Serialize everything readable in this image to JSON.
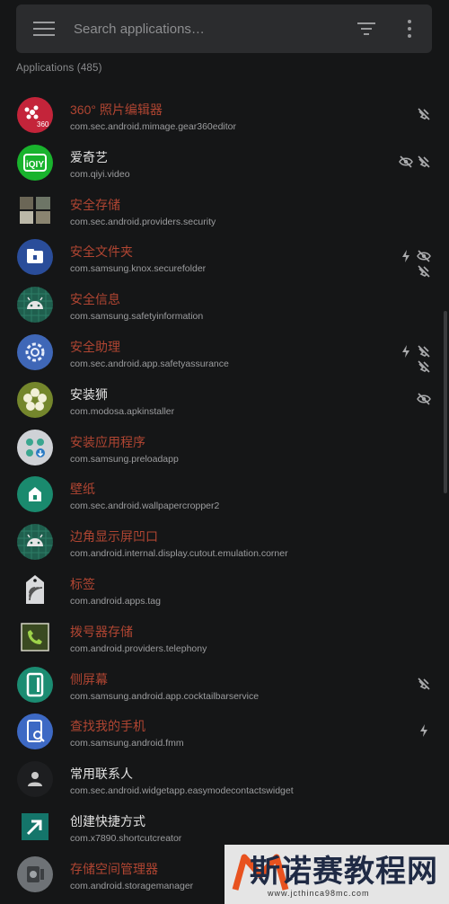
{
  "search": {
    "placeholder": "Search applications…"
  },
  "section_header": "Applications (485)",
  "colors": {
    "background": "#151617",
    "search_bar": "#2b2c2e",
    "disabled_text": "#b04532",
    "enabled_text": "#e2e2e2",
    "package_text": "#9c9d9f"
  },
  "apps": [
    {
      "name": "360° 照片编辑器",
      "package": "com.sec.android.mimage.gear360editor",
      "state": "disabled",
      "icon": "gear360-icon",
      "flags": [
        "ops-off-icon"
      ]
    },
    {
      "name": "爱奇艺",
      "package": "com.qiyi.video",
      "state": "enabled",
      "icon": "iqiyi-icon",
      "flags": [
        "hidden-icon",
        "ops-off-icon"
      ]
    },
    {
      "name": "安全存储",
      "package": "com.sec.android.providers.security",
      "state": "disabled",
      "icon": "storage-tiles-icon",
      "flags": []
    },
    {
      "name": "安全文件夹",
      "package": "com.samsung.knox.securefolder",
      "state": "disabled",
      "icon": "secure-folder-icon",
      "flags": [
        "trace-icon",
        "hidden-icon",
        "ops-off-icon"
      ]
    },
    {
      "name": "安全信息",
      "package": "com.samsung.safetyinformation",
      "state": "disabled",
      "icon": "android-icon",
      "flags": []
    },
    {
      "name": "安全助理",
      "package": "com.sec.android.app.safetyassurance",
      "state": "disabled",
      "icon": "settings-gear-icon",
      "flags": [
        "trace-icon",
        "ops-off-icon",
        "ops-off-icon"
      ]
    },
    {
      "name": "安装狮",
      "package": "com.modosa.apkinstaller",
      "state": "enabled",
      "icon": "flower-icon",
      "flags": [
        "hidden-icon"
      ]
    },
    {
      "name": "安装应用程序",
      "package": "com.samsung.preloadapp",
      "state": "disabled",
      "icon": "preload-app-icon",
      "flags": []
    },
    {
      "name": "壁纸",
      "package": "com.sec.android.wallpapercropper2",
      "state": "disabled",
      "icon": "wallpaper-icon",
      "flags": []
    },
    {
      "name": "边角显示屏凹口",
      "package": "com.android.internal.display.cutout.emulation.corner",
      "state": "disabled",
      "icon": "android-icon",
      "flags": []
    },
    {
      "name": "标签",
      "package": "com.android.apps.tag",
      "state": "disabled",
      "icon": "nfc-tag-icon",
      "flags": []
    },
    {
      "name": "拨号器存储",
      "package": "com.android.providers.telephony",
      "state": "disabled",
      "icon": "phone-icon",
      "flags": []
    },
    {
      "name": "侧屏幕",
      "package": "com.samsung.android.app.cocktailbarservice",
      "state": "disabled",
      "icon": "edge-screen-icon",
      "flags": [
        "ops-off-icon"
      ]
    },
    {
      "name": "查找我的手机",
      "package": "com.samsung.android.fmm",
      "state": "disabled",
      "icon": "find-phone-icon",
      "flags": [
        "trace-icon"
      ]
    },
    {
      "name": "常用联系人",
      "package": "com.sec.android.widgetapp.easymodecontactswidget",
      "state": "enabled",
      "icon": "contact-icon",
      "flags": []
    },
    {
      "name": "创建快捷方式",
      "package": "com.x7890.shortcutcreator",
      "state": "enabled",
      "icon": "shortcut-arrow-icon",
      "flags": []
    },
    {
      "name": "存储空间管理器",
      "package": "com.android.storagemanager",
      "state": "disabled",
      "icon": "storage-manager-icon",
      "flags": []
    }
  ],
  "watermark": {
    "title": "斯诺赛教程网",
    "url": "www.jcthinca98mc.com"
  }
}
